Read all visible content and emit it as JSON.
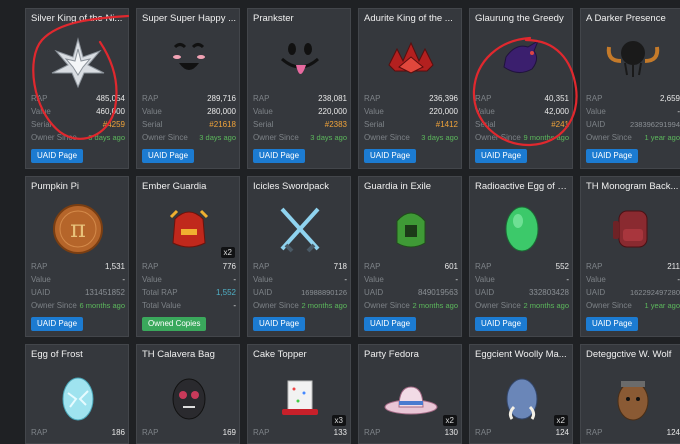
{
  "colors": {
    "card_bg": "#35383d",
    "page_bg": "#1f2124",
    "serial": "#f0a33a",
    "owner_since": "#5cb85c",
    "button_blue": "#1c7bd1",
    "button_green": "#3aa85c",
    "annotation_red": "#e0282e"
  },
  "rows": [
    [
      {
        "title": "Silver King of the Ni...",
        "icon": "silver-crown-icon",
        "rows": [
          {
            "label": "RAP",
            "value": "485,054"
          },
          {
            "label": "Value",
            "value": "460,000"
          },
          {
            "label": "Serial",
            "value": "#4259"
          },
          {
            "label": "Owner Since",
            "value": "3 days ago"
          }
        ],
        "button": "UAID Page"
      },
      {
        "title": "Super Super Happy ...",
        "icon": "happy-face-icon",
        "rows": [
          {
            "label": "RAP",
            "value": "289,716"
          },
          {
            "label": "Value",
            "value": "280,000"
          },
          {
            "label": "Serial",
            "value": "#21618"
          },
          {
            "label": "Owner Since",
            "value": "3 days ago"
          }
        ],
        "button": "UAID Page"
      },
      {
        "title": "Prankster",
        "icon": "prankster-face-icon",
        "rows": [
          {
            "label": "RAP",
            "value": "238,081"
          },
          {
            "label": "Value",
            "value": "220,000"
          },
          {
            "label": "Serial",
            "value": "#2383"
          },
          {
            "label": "Owner Since",
            "value": "3 days ago"
          }
        ],
        "button": "UAID Page"
      },
      {
        "title": "Adurite King of the ...",
        "icon": "red-crown-icon",
        "rows": [
          {
            "label": "RAP",
            "value": "236,396"
          },
          {
            "label": "Value",
            "value": "220,000"
          },
          {
            "label": "Serial",
            "value": "#1412"
          },
          {
            "label": "Owner Since",
            "value": "3 days ago"
          }
        ],
        "button": "UAID Page"
      },
      {
        "title": "Glaurung the Greedy",
        "icon": "purple-dragon-icon",
        "rows": [
          {
            "label": "RAP",
            "value": "40,351"
          },
          {
            "label": "Value",
            "value": "42,000"
          },
          {
            "label": "Serial",
            "value": "#241"
          },
          {
            "label": "Owner Since",
            "value": "9 months ago"
          }
        ],
        "button": "UAID Page"
      },
      {
        "title": "A Darker Presence",
        "icon": "dark-horned-helm-icon",
        "rows": [
          {
            "label": "RAP",
            "value": "2,659"
          },
          {
            "label": "Value",
            "value": "-"
          },
          {
            "label": "UAID",
            "value": "238396291994"
          },
          {
            "label": "Owner Since",
            "value": "1 year ago"
          }
        ],
        "button": "UAID Page"
      }
    ],
    [
      {
        "title": "Pumpkin Pi",
        "icon": "pumpkin-pi-icon",
        "rows": [
          {
            "label": "RAP",
            "value": "1,531"
          },
          {
            "label": "Value",
            "value": "-"
          },
          {
            "label": "UAID",
            "value": "131451852"
          },
          {
            "label": "Owner Since",
            "value": "6 months ago"
          }
        ],
        "button": "UAID Page"
      },
      {
        "title": "Ember Guardia",
        "icon": "ember-helm-icon",
        "badge": "x2",
        "rows": [
          {
            "label": "RAP",
            "value": "776"
          },
          {
            "label": "Value",
            "value": "-"
          },
          {
            "label": "Total RAP",
            "value": "1,552"
          },
          {
            "label": "Total Value",
            "value": "-"
          }
        ],
        "button": "Owned Copies"
      },
      {
        "title": "Icicles Swordpack",
        "icon": "crossed-swords-icon",
        "rows": [
          {
            "label": "RAP",
            "value": "718"
          },
          {
            "label": "Value",
            "value": "-"
          },
          {
            "label": "UAID",
            "value": "16988890126"
          },
          {
            "label": "Owner Since",
            "value": "2 months ago"
          }
        ],
        "button": "UAID Page"
      },
      {
        "title": "Guardia in Exile",
        "icon": "green-helm-icon",
        "rows": [
          {
            "label": "RAP",
            "value": "601"
          },
          {
            "label": "Value",
            "value": "-"
          },
          {
            "label": "UAID",
            "value": "849019563"
          },
          {
            "label": "Owner Since",
            "value": "2 months ago"
          }
        ],
        "button": "UAID Page"
      },
      {
        "title": "Radioactive Egg of U...",
        "icon": "radioactive-egg-icon",
        "rows": [
          {
            "label": "RAP",
            "value": "552"
          },
          {
            "label": "Value",
            "value": "-"
          },
          {
            "label": "UAID",
            "value": "332803428"
          },
          {
            "label": "Owner Since",
            "value": "2 months ago"
          }
        ],
        "button": "UAID Page"
      },
      {
        "title": "TH Monogram Back...",
        "icon": "backpack-icon",
        "rows": [
          {
            "label": "RAP",
            "value": "211"
          },
          {
            "label": "Value",
            "value": "-"
          },
          {
            "label": "UAID",
            "value": "162292497280"
          },
          {
            "label": "Owner Since",
            "value": "1 year ago"
          }
        ],
        "button": "UAID Page"
      }
    ],
    [
      {
        "title": "Egg of Frost",
        "icon": "frost-egg-icon",
        "rows": [
          {
            "label": "RAP",
            "value": "186"
          }
        ]
      },
      {
        "title": "TH Calavera Bag",
        "icon": "calavera-bag-icon",
        "rows": [
          {
            "label": "RAP",
            "value": "169"
          }
        ]
      },
      {
        "title": "Cake Topper",
        "icon": "cake-hat-icon",
        "badge": "x3",
        "rows": [
          {
            "label": "RAP",
            "value": "133"
          }
        ]
      },
      {
        "title": "Party Fedora",
        "icon": "fedora-icon",
        "badge": "x2",
        "rows": [
          {
            "label": "RAP",
            "value": "130"
          }
        ]
      },
      {
        "title": "Eggcient Woolly Ma...",
        "icon": "mammoth-egg-icon",
        "badge": "x2",
        "rows": [
          {
            "label": "RAP",
            "value": "124"
          }
        ]
      },
      {
        "title": "Deteggctive W. Wolf",
        "icon": "wolf-egg-icon",
        "rows": [
          {
            "label": "RAP",
            "value": "124"
          }
        ]
      }
    ]
  ]
}
